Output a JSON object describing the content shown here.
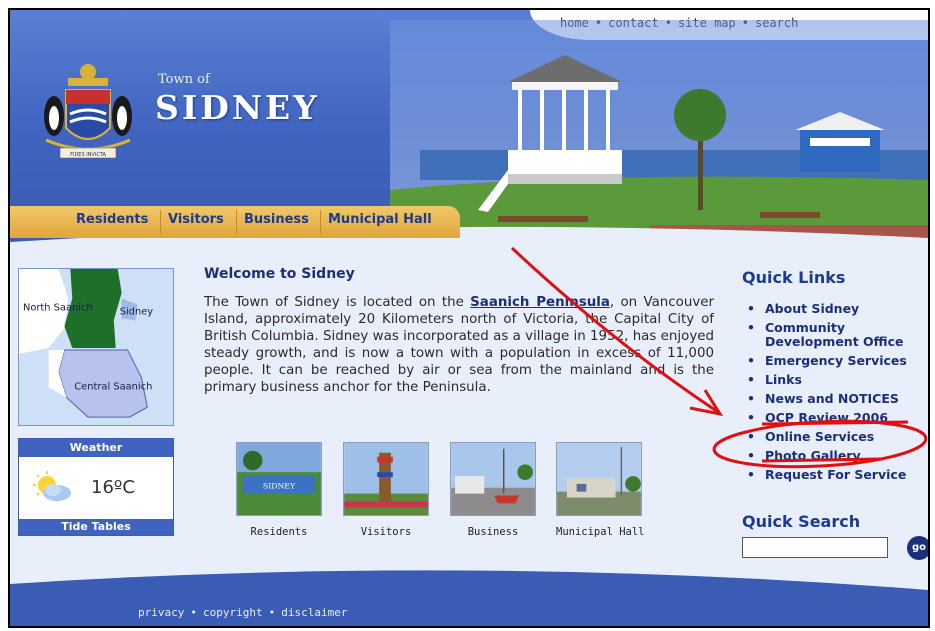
{
  "topnav": {
    "items": [
      "home",
      "contact",
      "site map",
      "search"
    ],
    "separator": "•"
  },
  "brand": {
    "town_of": "Town of",
    "town_name": "SIDNEY",
    "crest_motto": "FIDES INVICTA"
  },
  "main_nav": [
    "Residents",
    "Visitors",
    "Business",
    "Municipal Hall"
  ],
  "map": {
    "labels": [
      "North Saanich",
      "Sidney",
      "Central Saanich"
    ]
  },
  "weather": {
    "header": "Weather",
    "temperature": "16ºC",
    "icon": "partly-cloudy-icon",
    "tide_label": "Tide Tables"
  },
  "welcome": {
    "title": "Welcome to Sidney",
    "text_before_link": "The Town of Sidney is located on the ",
    "link": "Saanich Peninsula",
    "text_after_link": ", on Vancouver Island, approximately 20 Kilometers north of Victoria, the Capital City of British Columbia. Sidney was incorporated as a village in 1952, has enjoyed steady growth, and is now a town with a population in excess of 11,000 people.  It can be reached by air or sea from the mainland and is the primary business anchor for the Peninsula."
  },
  "tiles": [
    "Residents",
    "Visitors",
    "Business",
    "Municipal Hall"
  ],
  "quick_links": {
    "title": "Quick Links",
    "items": [
      "About Sidney",
      "Community Development Office",
      "Emergency Services",
      "Links",
      "News and NOTICES",
      "OCP Review 2006",
      "Online Services",
      "Photo Gallery",
      "Request For Service"
    ]
  },
  "quick_search": {
    "title": "Quick Search",
    "value": "",
    "go_label": "go"
  },
  "footer": {
    "items": [
      "privacy",
      "copyright",
      "disclaimer"
    ],
    "separator": "•"
  },
  "colors": {
    "header_blue": "#3f63bf",
    "nav_gold": "#e0a53a",
    "link_navy": "#1c2f7a",
    "annotation_red": "#e01010"
  }
}
